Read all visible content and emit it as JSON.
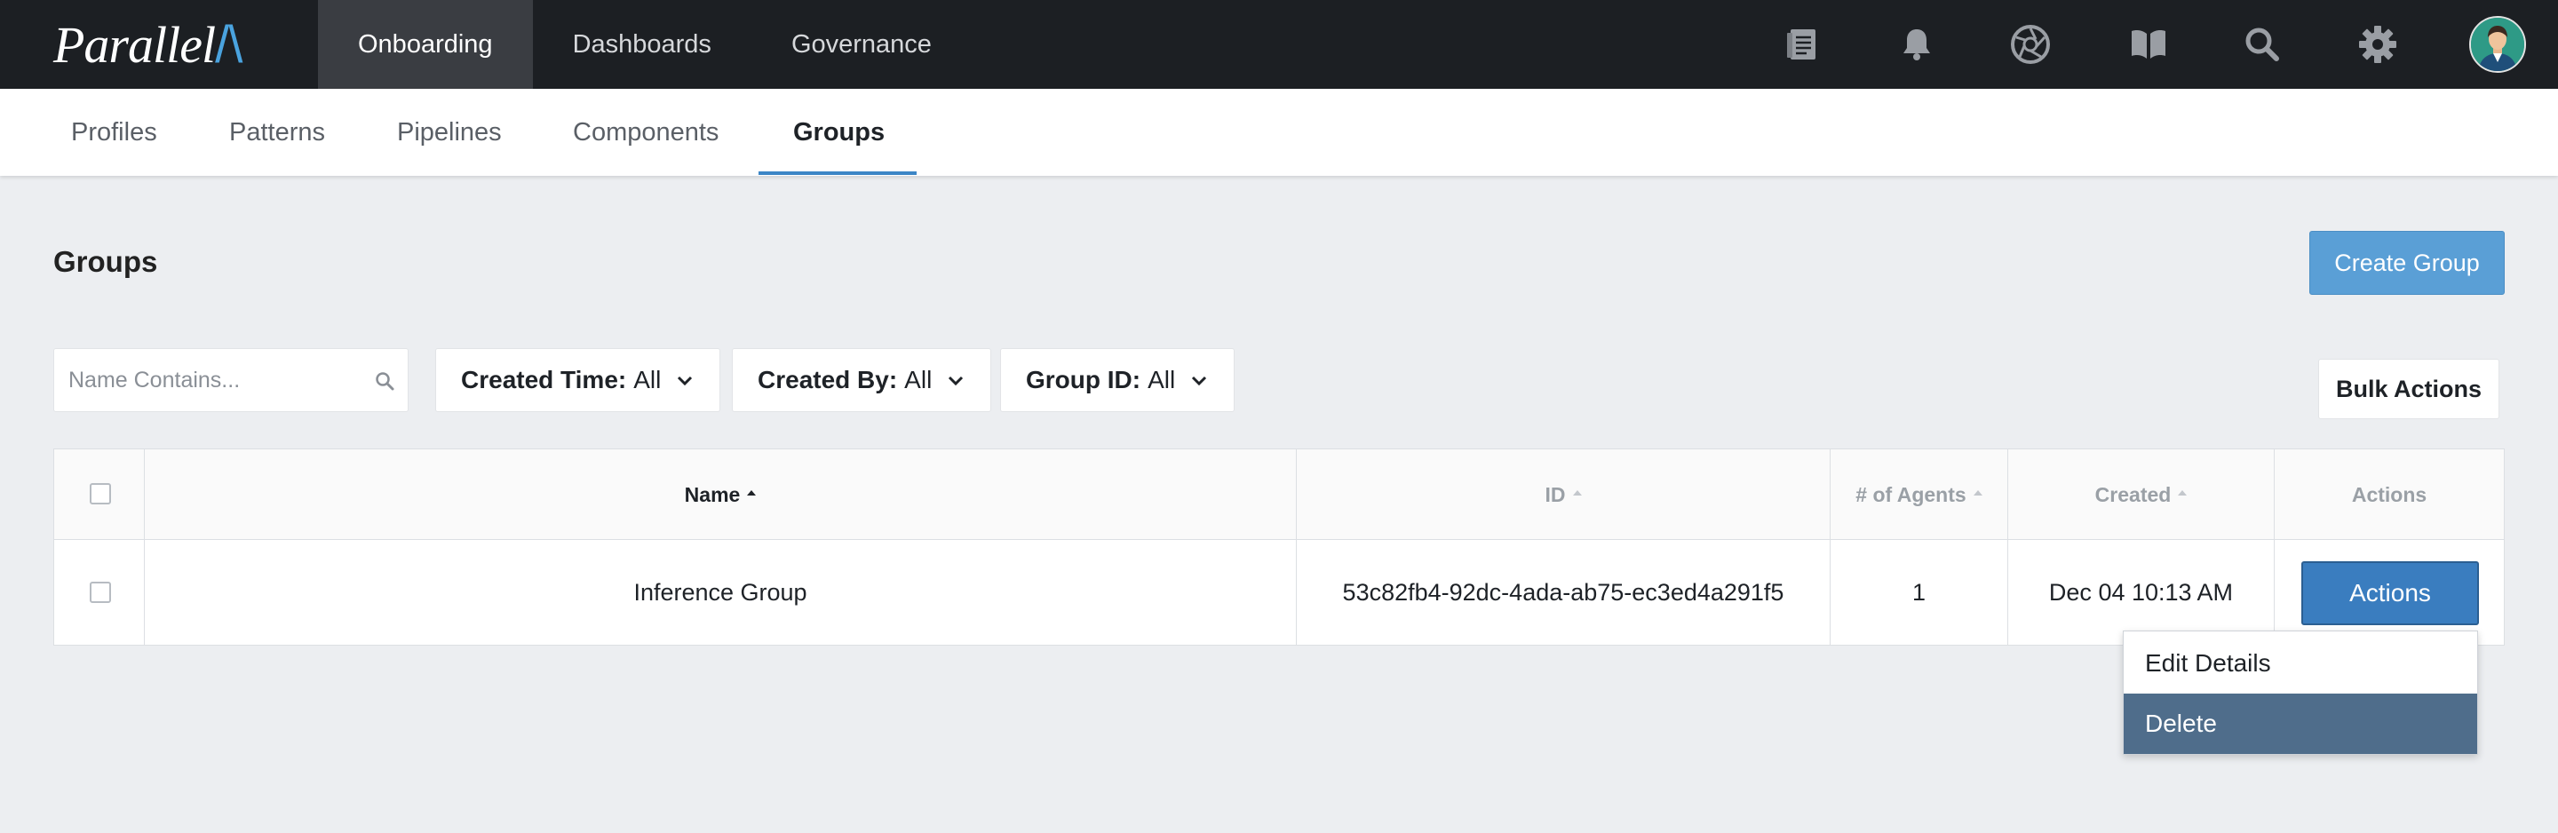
{
  "app": {
    "logo_text": "Parallel",
    "logo_mark": "/\\",
    "colors": {
      "topbar": "#1c1f23",
      "accent": "#3c86c6",
      "primary_button": "#5a9fd6",
      "actions_button": "#3a7dbf",
      "menu_hover": "#4f6d8b",
      "page_bg": "#eceef1"
    }
  },
  "topnav": {
    "items": [
      {
        "label": "Onboarding",
        "active": true
      },
      {
        "label": "Dashboards",
        "active": false
      },
      {
        "label": "Governance",
        "active": false
      }
    ],
    "icons": [
      "document-icon",
      "bell-icon",
      "aperture-icon",
      "book-icon",
      "search-icon",
      "gear-icon",
      "avatar"
    ]
  },
  "subnav": {
    "tabs": [
      {
        "label": "Profiles",
        "active": false
      },
      {
        "label": "Patterns",
        "active": false
      },
      {
        "label": "Pipelines",
        "active": false
      },
      {
        "label": "Components",
        "active": false
      },
      {
        "label": "Groups",
        "active": true
      }
    ]
  },
  "page": {
    "title": "Groups",
    "create_button": "Create Group",
    "bulk_button": "Bulk Actions"
  },
  "filters": {
    "search_placeholder": "Name Contains...",
    "search_value": "",
    "items": [
      {
        "label": "Created Time:",
        "value": "All"
      },
      {
        "label": "Created By:",
        "value": "All"
      },
      {
        "label": "Group ID:",
        "value": "All"
      }
    ]
  },
  "table": {
    "columns": [
      {
        "label": "Name",
        "sorted": true
      },
      {
        "label": "ID",
        "sorted": false
      },
      {
        "label": "# of Agents",
        "sorted": false
      },
      {
        "label": "Created",
        "sorted": false
      },
      {
        "label": "Actions",
        "sorted": false
      }
    ],
    "rows": [
      {
        "checked": false,
        "name": "Inference Group",
        "id": "53c82fb4-92dc-4ada-ab75-ec3ed4a291f5",
        "agents": "1",
        "created": "Dec 04 10:13 AM",
        "action_label": "Actions"
      }
    ]
  },
  "actions_menu": {
    "items": [
      {
        "label": "Edit Details",
        "highlighted": false
      },
      {
        "label": "Delete",
        "highlighted": true
      }
    ]
  }
}
